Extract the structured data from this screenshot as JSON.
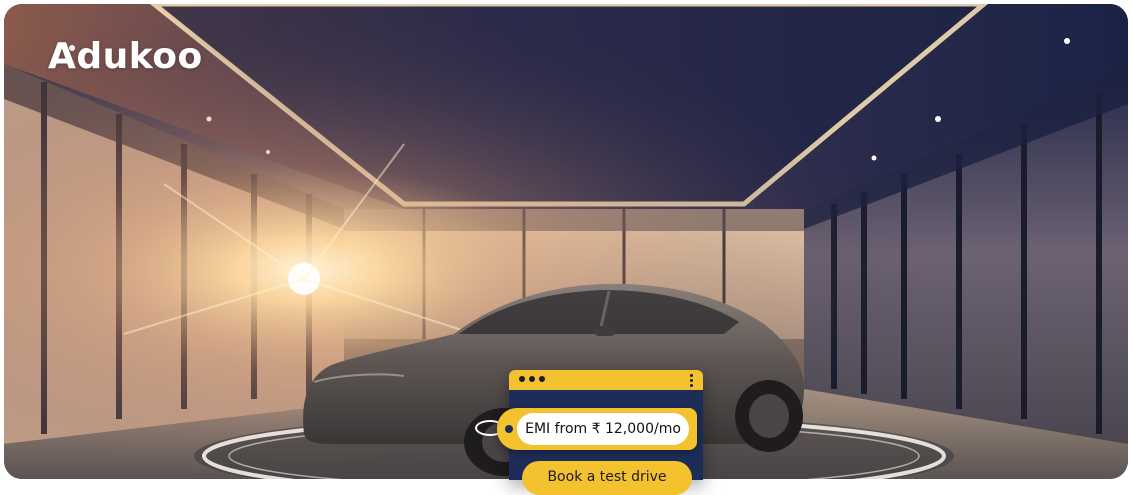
{
  "brand": {
    "name": "Adukoo"
  },
  "widget": {
    "emi_label": "EMI from ₹ 12,000/mo",
    "test_drive_label": "Book a test drive"
  },
  "colors": {
    "accent": "#f4c22e",
    "widget_bg": "#1d2d58",
    "sky_dark": "#1e2240",
    "sun": "#ffd9a0"
  },
  "icons": {
    "window_dots": "three-dots-icon",
    "menu": "kebab-menu-icon",
    "tag": "price-tag-icon"
  }
}
